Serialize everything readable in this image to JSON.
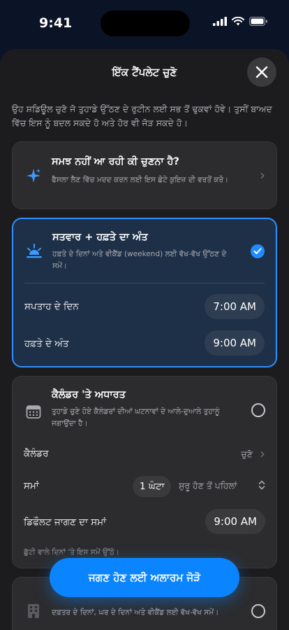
{
  "status_bar": {
    "time": "9:41"
  },
  "sheet": {
    "title": "ਇੱਕ ਟੈਂਪਲੇਟ ਚੁਣੋ",
    "intro": "ਉਹ ਸ਼ਡਿਊਲ ਚੁਣੋ ਜੋ ਤੁਹਾਡੇ ਉੱਠਣ ਦੇ ਰੁਟੀਨ ਲਈ ਸਭ ਤੋਂ ਢੁਕਵਾਂ ਹੋਵੇ। ਤੁਸੀਂ ਬਾਅਦ ਵਿੱਚ ਇਸ ਨੂੰ ਬਦਲ ਸਕਦੇ ਹੋ ਅਤੇ ਹੋਰ ਵੀ ਜੋੜ ਸਕਦੇ ਹੋ।"
  },
  "templates": {
    "help": {
      "title": "ਸਮਝ ਨਹੀਂ ਆ ਰਹੀ ਕੀ ਚੁਣਨਾ ਹੈ?",
      "desc": "ਫੈਸਲਾ ਲੈਣ ਵਿੱਚ ਮਦਦ ਕਰਨ ਲਈ ਇਸ ਛੋਟੇ ਕੁਇਜ਼ ਦੀ ਵਰਤੋਂ ਕਰੋ।"
    },
    "weekday": {
      "title": "ਸਤਵਾਰ + ਹਫ਼ਤੇ ਦਾ ਅੰਤ",
      "desc": "ਹਫ਼ਤੇ ਦੇ ਦਿਨਾਂ ਅਤੇ ਵੀਕੈਂਡ (weekend) ਲਈ ਵੱਖ-ਵੱਖ ਉੱਠਣ ਦੇ ਸਮੇਂ।",
      "selected": true,
      "weekdays_label": "ਸਪਤਾਹ ਦੇ ਦਿਨ",
      "weekdays_time": "7:00 AM",
      "weekend_label": "ਹਫ਼ਤੇ ਦੇ ਅੰਤ",
      "weekend_time": "9:00 AM"
    },
    "calendar": {
      "title": "ਕੈਲੰਡਰ 'ਤੇ ਅਧਾਰਤ",
      "desc": "ਤੁਹਾਡੇ ਚੁਣੇ ਹੋਏ ਕੈਲੰਡਰਾਂ ਦੀਆਂ ਘਟਨਾਵਾਂ ਦੇ ਆਲੇ-ਦੁਆਲੇ ਤੁਹਾਨੂੰ ਜਗਾਉਂਦਾ ਹੈ।",
      "calendar_label": "ਕੈਲੰਡਰ",
      "calendar_value": "ਚੁਣੋ",
      "time_label": "ਸਮਾਂ",
      "time_value": "1 ਘੰਟਾ",
      "time_suffix": "ਸ਼ੁਰੂ ਹੋਣ ਤੋਂ ਪਹਿਲਾਂ",
      "default_label": "ਡਿਫੌਲਟ ਜਾਗਣ ਦਾ ਸਮਾਂ",
      "default_time": "9:00 AM",
      "hint": "ਛੁੱਟੀ ਵਾਲੇ ਦਿਨਾਂ 'ਤੇ ਇਸ ਸਮੇਂ ਉੱਠੋ।"
    },
    "hidden": {
      "desc": "ਦਫ਼ਤਰ ਦੇ ਦਿਨਾਂ, ਘਰ ਦੇ ਦਿਨਾਂ ਅਤੇ ਵੀਕੈਂਡ ਲਈ ਵੱਖ-ਵੱਖ ਸਮੇਂ।"
    }
  },
  "cta": {
    "label": "ਜਗਣ ਹੋਣ ਲਈ ਅਲਾਰਮ ਜੋੜੋ"
  },
  "icons": {
    "close": "close-icon",
    "sparkle": "sparkle-icon",
    "sunrise": "sunrise-icon",
    "calendar": "calendar-icon",
    "office": "office-icon"
  },
  "colors": {
    "accent": "#0a84ff",
    "selected_bg": "#1d3047",
    "sheet_bg": "#1c1c1e"
  }
}
